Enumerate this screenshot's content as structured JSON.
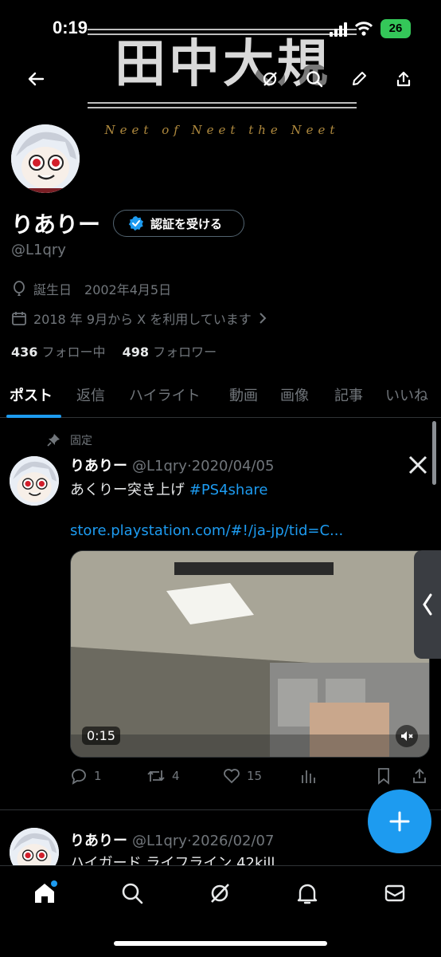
{
  "status_bar": {
    "time": "0:19",
    "battery": "26"
  },
  "banner": {
    "title": "田中大規",
    "subtitle": "Neet of Neet the Neet"
  },
  "profile": {
    "name": "りありー",
    "verify_label": "認証を受ける",
    "handle": "@L1qry",
    "birthday_label": "誕生日",
    "birthday_value": "2002年4月5日",
    "joined": "2018 年 9月から X を利用しています",
    "following_count": "436",
    "following_label": "フォロー中",
    "followers_count": "498",
    "followers_label": "フォロワー"
  },
  "tabs": [
    "ポスト",
    "返信",
    "ハイライト",
    "動画",
    "画像",
    "記事",
    "いいね"
  ],
  "posts": [
    {
      "pinned_label": "固定",
      "name": "りありー",
      "handle": "@L1qry",
      "date": "2020/04/05",
      "text": "あくりー突き上げ",
      "hashtag": "#PS4share",
      "link": "store.playstation.com/#!/ja-jp/tid=C...",
      "video_time": "0:15",
      "replies": "1",
      "reposts": "4",
      "likes": "15"
    },
    {
      "name": "りありー",
      "handle": "@L1qry",
      "date": "2026/02/07",
      "text": "ハイガード ライフライン 42kill"
    }
  ],
  "colors": {
    "accent": "#1d9bf0",
    "background": "#000000",
    "muted": "#71767b"
  }
}
